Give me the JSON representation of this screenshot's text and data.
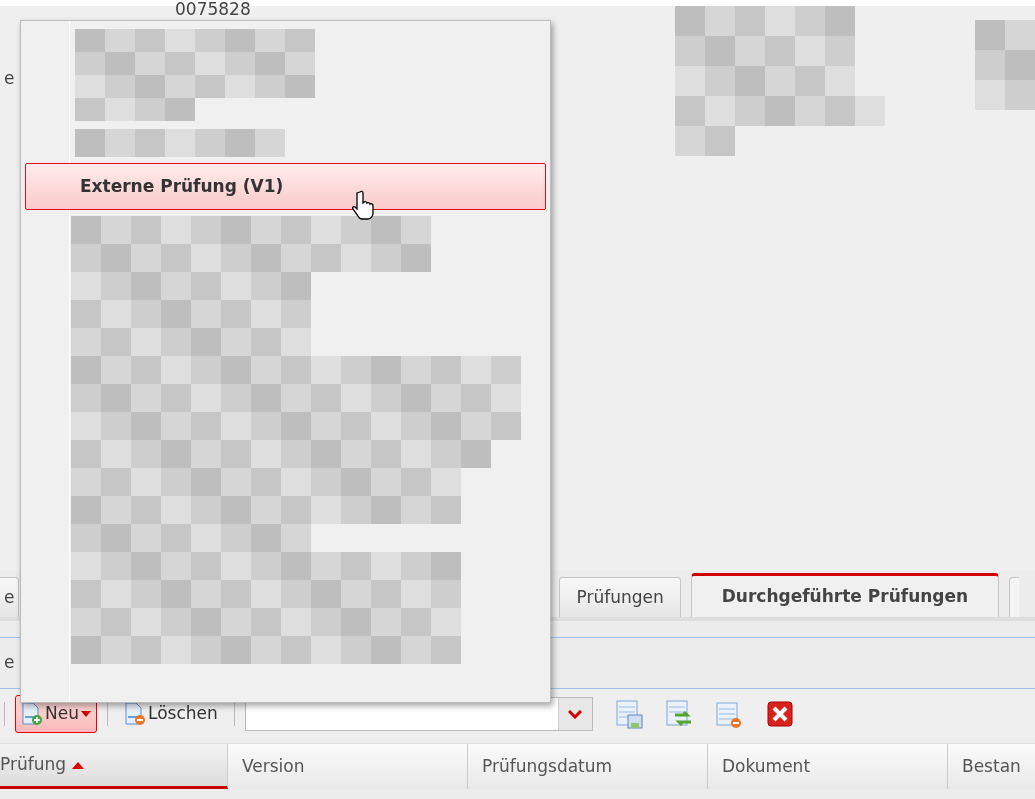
{
  "background": {
    "record_number": "0075828",
    "label_fragment": "e"
  },
  "menu": {
    "items": [
      {
        "kind": "blurred"
      },
      {
        "kind": "blurred"
      },
      {
        "kind": "entry",
        "label": "Externe Prüfung (V1)",
        "selected": true
      },
      {
        "kind": "blurred"
      }
    ]
  },
  "tabs": [
    {
      "label": "e",
      "selected": false
    },
    {
      "label": "Prüfungen",
      "selected": false
    },
    {
      "label": "Durchgeführte Prüfungen",
      "selected": true
    }
  ],
  "panel": {
    "label_fragment": "e"
  },
  "toolbar": {
    "buttons": [
      {
        "label": "Neu",
        "kind": "new",
        "has_menu": true,
        "highlighted": true
      },
      {
        "label": "Löschen",
        "kind": "delete",
        "has_menu": false,
        "highlighted": false
      }
    ]
  },
  "table": {
    "columns": [
      {
        "label": "Prüfung",
        "sorted": true
      },
      {
        "label": "Version",
        "sorted": false
      },
      {
        "label": "Prüfungsdatum",
        "sorted": false
      },
      {
        "label": "Dokument",
        "sorted": false
      },
      {
        "label": "Bestan",
        "sorted": false
      }
    ]
  }
}
